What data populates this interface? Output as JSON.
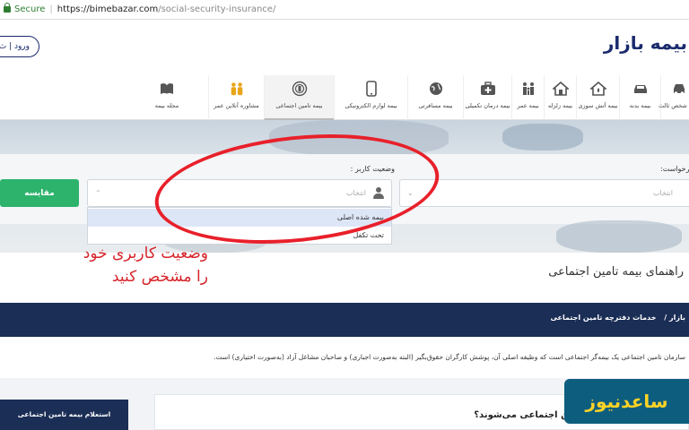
{
  "browser": {
    "secure_label": "Secure",
    "url_host": "https://bimebazar.com",
    "url_path": "/social-security-insurance/"
  },
  "header": {
    "login_label": "ورود | ث",
    "logo_text": "بیمه بازار"
  },
  "nav": {
    "items": [
      {
        "label": "بیمه شخص ثالث",
        "icon": "car-icon"
      },
      {
        "label": "بیمه بدنه",
        "icon": "car-body-icon"
      },
      {
        "label": "بیمه آتش سوزی",
        "icon": "house-fire-icon"
      },
      {
        "label": "بیمه زلزله",
        "icon": "house-icon"
      },
      {
        "label": "بیمه عمر",
        "icon": "family-icon"
      },
      {
        "label": "بیمه درمان تکمیلی",
        "icon": "medical-kit-icon"
      },
      {
        "label": "بیمه مسافرتی",
        "icon": "globe-icon"
      },
      {
        "label": "بیمه لوازم الکترونیکی",
        "icon": "mobile-icon"
      },
      {
        "label": "بیمه تامین اجتماعی",
        "icon": "social-security-icon"
      },
      {
        "label": "مشاوره آنلاین عمر",
        "icon": "people-icon"
      },
      {
        "label": "مجله بیمه",
        "icon": "magazine-icon"
      }
    ]
  },
  "form": {
    "request_label": "درخواست:",
    "request_placeholder": "انتخاب",
    "user_status_label": "وضعیت کاربر :",
    "user_status_placeholder": "انتخاب",
    "compare_button": "مقایسه",
    "options": [
      "بیمه شده اصلی",
      "تحت تکفل"
    ]
  },
  "annotation": {
    "line1": "وضعیت کاربری خود",
    "line2": "را مشخص کنید"
  },
  "guide": {
    "title": "راهنمای بیمه تامین اجتماعی"
  },
  "breadcrumb": {
    "home": "بازار",
    "current": "خدمات دفترچه تامین اجتماعی"
  },
  "intro_text": "سازمان تامین اجتماعی یک بیمه‌گر اجتماعی است که وظیفه اصلی آن، پوشش کارگران حقوق‌بگیر (البته به‌صورت اجباری) و صاحبان مشاغل آزاد (به‌صورت اختیاری) است.",
  "sidebar": {
    "card_title": "استعلام بیمه تامین اجتماعی"
  },
  "faq": {
    "question": "چه کسانی شامل بیمه تامین اجتماعی می‌شوند؟"
  },
  "watermark": {
    "text": "ساعدنیوز"
  }
}
